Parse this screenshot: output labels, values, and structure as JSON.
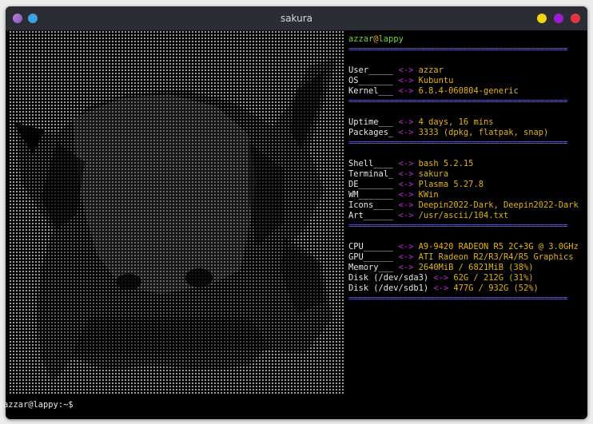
{
  "window": {
    "title": "sakura"
  },
  "header": {
    "user": "azzar",
    "at": "@",
    "host": "lappy"
  },
  "separator": "================================================",
  "groups": [
    [
      {
        "key": "User_____",
        "arrow": "<->",
        "value": "azzar"
      },
      {
        "key": "OS_______",
        "arrow": "<->",
        "value": "Kubuntu"
      },
      {
        "key": "Kernel___",
        "arrow": "<->",
        "value": "6.8.4-060804-generic"
      }
    ],
    [
      {
        "key": "Uptime___",
        "arrow": "<->",
        "value": "4 days, 16 mins"
      },
      {
        "key": "Packages_",
        "arrow": "<->",
        "value": "3333 (dpkg, flatpak, snap)"
      }
    ],
    [
      {
        "key": "Shell____",
        "arrow": "<->",
        "value": "bash 5.2.15"
      },
      {
        "key": "Terminal_",
        "arrow": "<->",
        "value": "sakura"
      },
      {
        "key": "DE_______",
        "arrow": "<->",
        "value": "Plasma 5.27.8"
      },
      {
        "key": "WM_______",
        "arrow": "<->",
        "value": "KWin"
      },
      {
        "key": "Icons____",
        "arrow": "<->",
        "value": "Deepin2022-Dark, Deepin2022-Dark"
      },
      {
        "key": "Art______",
        "arrow": "<->",
        "value": "/usr/ascii/104.txt"
      }
    ],
    [
      {
        "key": "CPU______",
        "arrow": "<->",
        "value": "A9-9420 RADEON R5 2C+3G @ 3.0GHz"
      },
      {
        "key": "GPU______",
        "arrow": "<->",
        "value": "ATI Radeon R2/R3/R4/R5 Graphics"
      },
      {
        "key": "Memory___",
        "arrow": "<->",
        "value": "2640MiB / 6821MiB (38%)"
      },
      {
        "key": "Disk (/dev/sda3)",
        "arrow": "<->",
        "value": "62G / 212G (31%)"
      },
      {
        "key": "Disk (/dev/sdb1)",
        "arrow": "<->",
        "value": "477G / 932G (52%)"
      }
    ]
  ],
  "prompt": "azzar@lappy:~$ ",
  "colors": {
    "username": "#7ad33a",
    "value": "#e2b313",
    "arrow": "#c12ad8",
    "separator": "#6a5cf0"
  }
}
